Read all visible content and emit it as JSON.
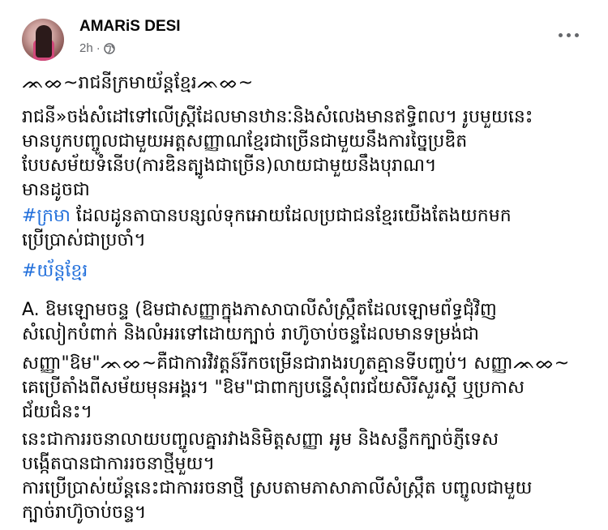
{
  "post": {
    "author": "AMARiS DESI",
    "time": "2h",
    "audience_icon": "globe-icon",
    "more_icon": "more-options-icon",
    "lines": [
      "ᨏᨖ~រាជនីក្រមាយ័ន្តខ្មែរᨏᨖ~",
      "រាជនី»ចង់សំដៅទៅលើស្រ្តីដែលមានឋានៈនិងសំលេងមានឥទ្ធិពល។ រូបមួយនេះ",
      "មានបូកបញ្ចូលជាមួយអត្តសញ្ញាណខ្មែរជាច្រើនជាមួយនឹងការច្នៃប្រឌិត",
      "បែបសម័យទំនើប(ការឌិនត្បូងជាច្រើន)លាយជាមួយនឹងបុរាណ។",
      "មានដូចជា",
      "ដែលដូនតាបានបន្សល់ទុកអោយដែលប្រជាជនខ្មែរយើងតែងយកមក",
      "ប្រើប្រាស់ជាប្រចាំ។",
      "A. ឱមឡោមចន្ទ (ឱមជាសញ្ញាក្នុងភាសាបាលីសំស្ក្រឹតដែលឡោមព័ទ្ធជុំវិញ",
      "សំលៀកបំពាក់ និងលំអរទៅដោយក្បាច់ រាហ៊ូចាប់ចន្ទដែលមានទម្រង់ជា",
      "សញ្ញា\"ឱម\"ᨏᨖ~គឺជាការវិវត្តន៍រីកចម្រើនជារាងរហូតគ្មានទីបញ្ចប់។ សញ្ញាᨏᨖ~",
      "គេប្រើតាំងពីសម័យមុនអង្គរ។ \"ឱម\"ជាពាក្យបន្ទើសុំពរជ័យសិរីសួរស្តី ឬប្រកាស",
      "ជ័យជំនះ។",
      "នេះជាការរចនាលាយបញ្ចូលគ្នារវាងនិមិត្តសញ្ញា អូម និងសន្លឹកក្បាច់ភ្ញីទេស",
      "បង្កើតបានជាការរចនាថ្មីមួយ។",
      "ការប្រើប្រាស់យ័ន្តនេះជាការរចនាថ្មី ស្របតាមភាសាភាលីសំស្ក្រឹត បញ្ចូលជាមួយ",
      "ក្បាច់រាហ៊ូចាប់ចន្ទ។"
    ],
    "hashtags": [
      "#ក្រមា",
      "#យ័ន្តខ្មែរ"
    ]
  }
}
